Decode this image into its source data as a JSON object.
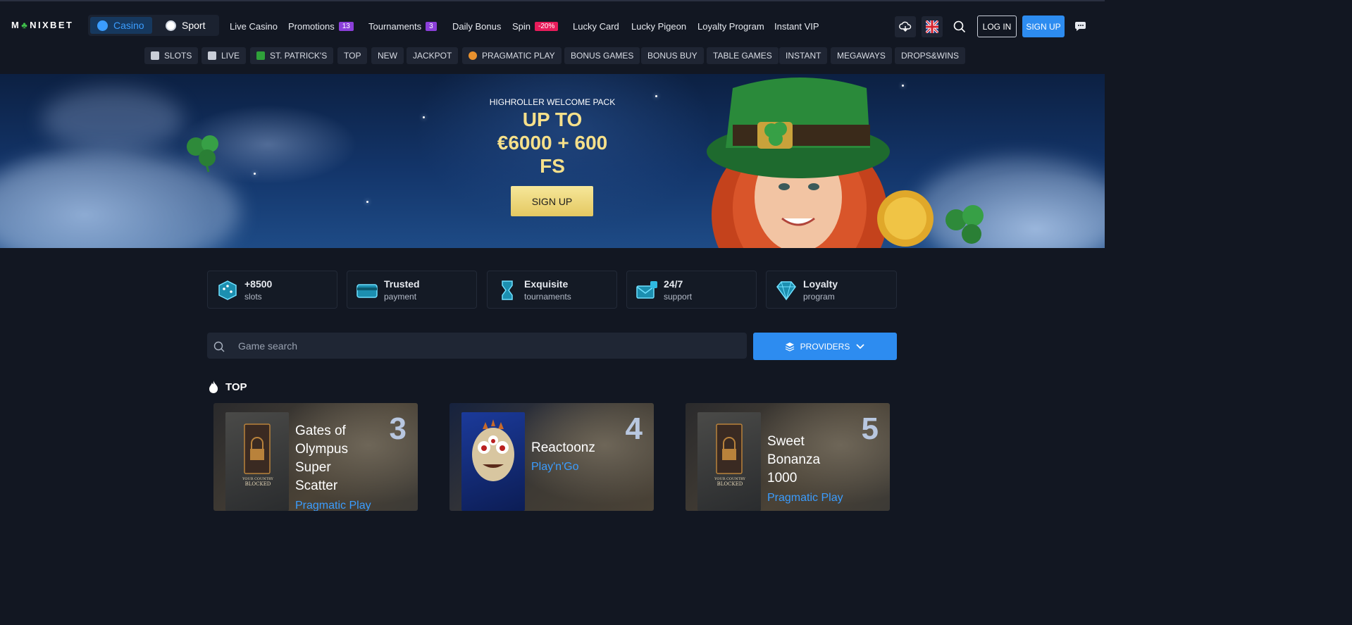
{
  "brand": {
    "logo_text_a": "M",
    "logo_text_b": "NIXBET"
  },
  "mode_toggle": {
    "casino": "Casino",
    "sport": "Sport"
  },
  "nav": [
    {
      "label": "Live Casino"
    },
    {
      "label": "Promotions",
      "badge": "13",
      "badge_color": "#8b3fd9"
    },
    {
      "label": "Tournaments",
      "badge": "3",
      "badge_color": "#8b3fd9"
    },
    {
      "label": "Daily Bonus"
    },
    {
      "label": "Spin",
      "badge": "-20%",
      "badge_color": "#e81c5b"
    },
    {
      "label": "Lucky Card"
    },
    {
      "label": "Lucky Pigeon"
    },
    {
      "label": "Loyalty Program"
    },
    {
      "label": "Instant VIP"
    }
  ],
  "header_actions": {
    "login": "LOG IN",
    "signup": "SIGN UP",
    "language": "EN"
  },
  "categories": [
    "SLOTS",
    "LIVE",
    "ST. PATRICK'S",
    "TOP",
    "NEW",
    "JACKPOT",
    "PRAGMATIC PLAY",
    "BONUS GAMES",
    "BONUS BUY",
    "TABLE GAMES",
    "INSTANT",
    "MEGAWAYS",
    "DROPS&WINS"
  ],
  "hero": {
    "eyebrow": "HIGHROLLER WELCOME PACK",
    "line1": "UP TO",
    "line2": "€6000 + 600",
    "line3": "FS",
    "cta": "SIGN UP"
  },
  "features": [
    {
      "title": "+8500",
      "subtitle": "slots"
    },
    {
      "title": "Trusted",
      "subtitle": "payment"
    },
    {
      "title": "Exquisite",
      "subtitle": "tournaments"
    },
    {
      "title": "24/7",
      "subtitle": "support"
    },
    {
      "title": "Loyalty",
      "subtitle": "program"
    }
  ],
  "search": {
    "placeholder": "Game search",
    "providers_label": "PROVIDERS"
  },
  "section": {
    "title": "TOP"
  },
  "games": [
    {
      "rank": "3",
      "name_lines": [
        "Gates of",
        "Olympus",
        "Super",
        "Scatter"
      ],
      "provider": "Pragmatic Play",
      "thumb": "blocked"
    },
    {
      "rank": "4",
      "name_lines": [
        "Reactoonz"
      ],
      "provider": "Play'n'Go",
      "thumb": "monster"
    },
    {
      "rank": "5",
      "name_lines": [
        "Sweet",
        "Bonanza",
        "1000"
      ],
      "provider": "Pragmatic Play",
      "thumb": "blocked"
    }
  ],
  "thumb_text": {
    "blocked_l1": "YOUR COUNTRY",
    "blocked_l2": "BLOCKED"
  },
  "colors": {
    "accent": "#2d8cf0",
    "gold": "#f6e08a",
    "background": "#121722"
  }
}
